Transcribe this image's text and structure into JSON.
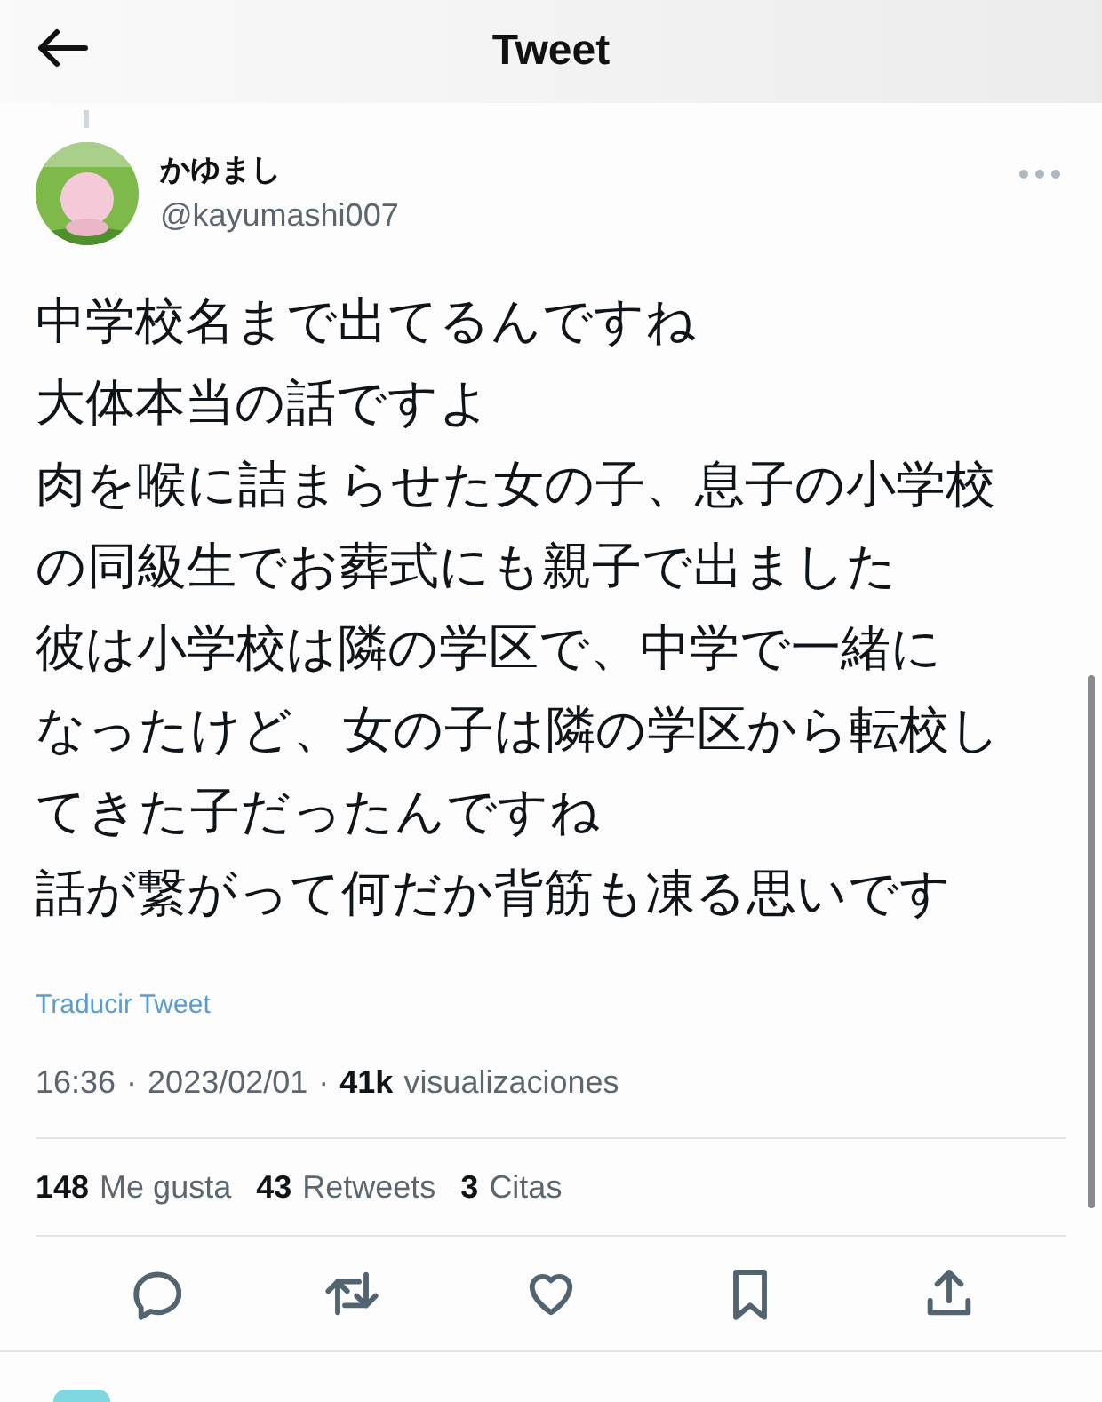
{
  "header": {
    "title": "Tweet"
  },
  "author": {
    "name": "かゆまし",
    "handle": "@kayumashi007"
  },
  "body_lines": [
    "中学校名まで出てるんですね",
    "大体本当の話ですよ",
    "肉を喉に詰まらせた女の子、息子の小学校",
    "の同級生でお葬式にも親子で出ました",
    "彼は小学校は隣の学区で、中学で一緒に",
    "なったけど、女の子は隣の学区から転校し",
    "てきた子だったんですね",
    "話が繋がって何だか背筋も凍る思いです"
  ],
  "translate_link": "Traducir Tweet",
  "meta": {
    "time": "16:36",
    "separator_1": "·",
    "date": "2023/02/01",
    "separator_2": "·",
    "views_count": "41k",
    "views_label": "visualizaciones"
  },
  "stats": [
    {
      "count": "148",
      "label": "Me gusta"
    },
    {
      "count": "43",
      "label": "Retweets"
    },
    {
      "count": "3",
      "label": "Citas"
    }
  ],
  "actions": [
    {
      "kind": "reply"
    },
    {
      "kind": "retweet"
    },
    {
      "kind": "like"
    },
    {
      "kind": "bookmark"
    },
    {
      "kind": "share"
    }
  ]
}
